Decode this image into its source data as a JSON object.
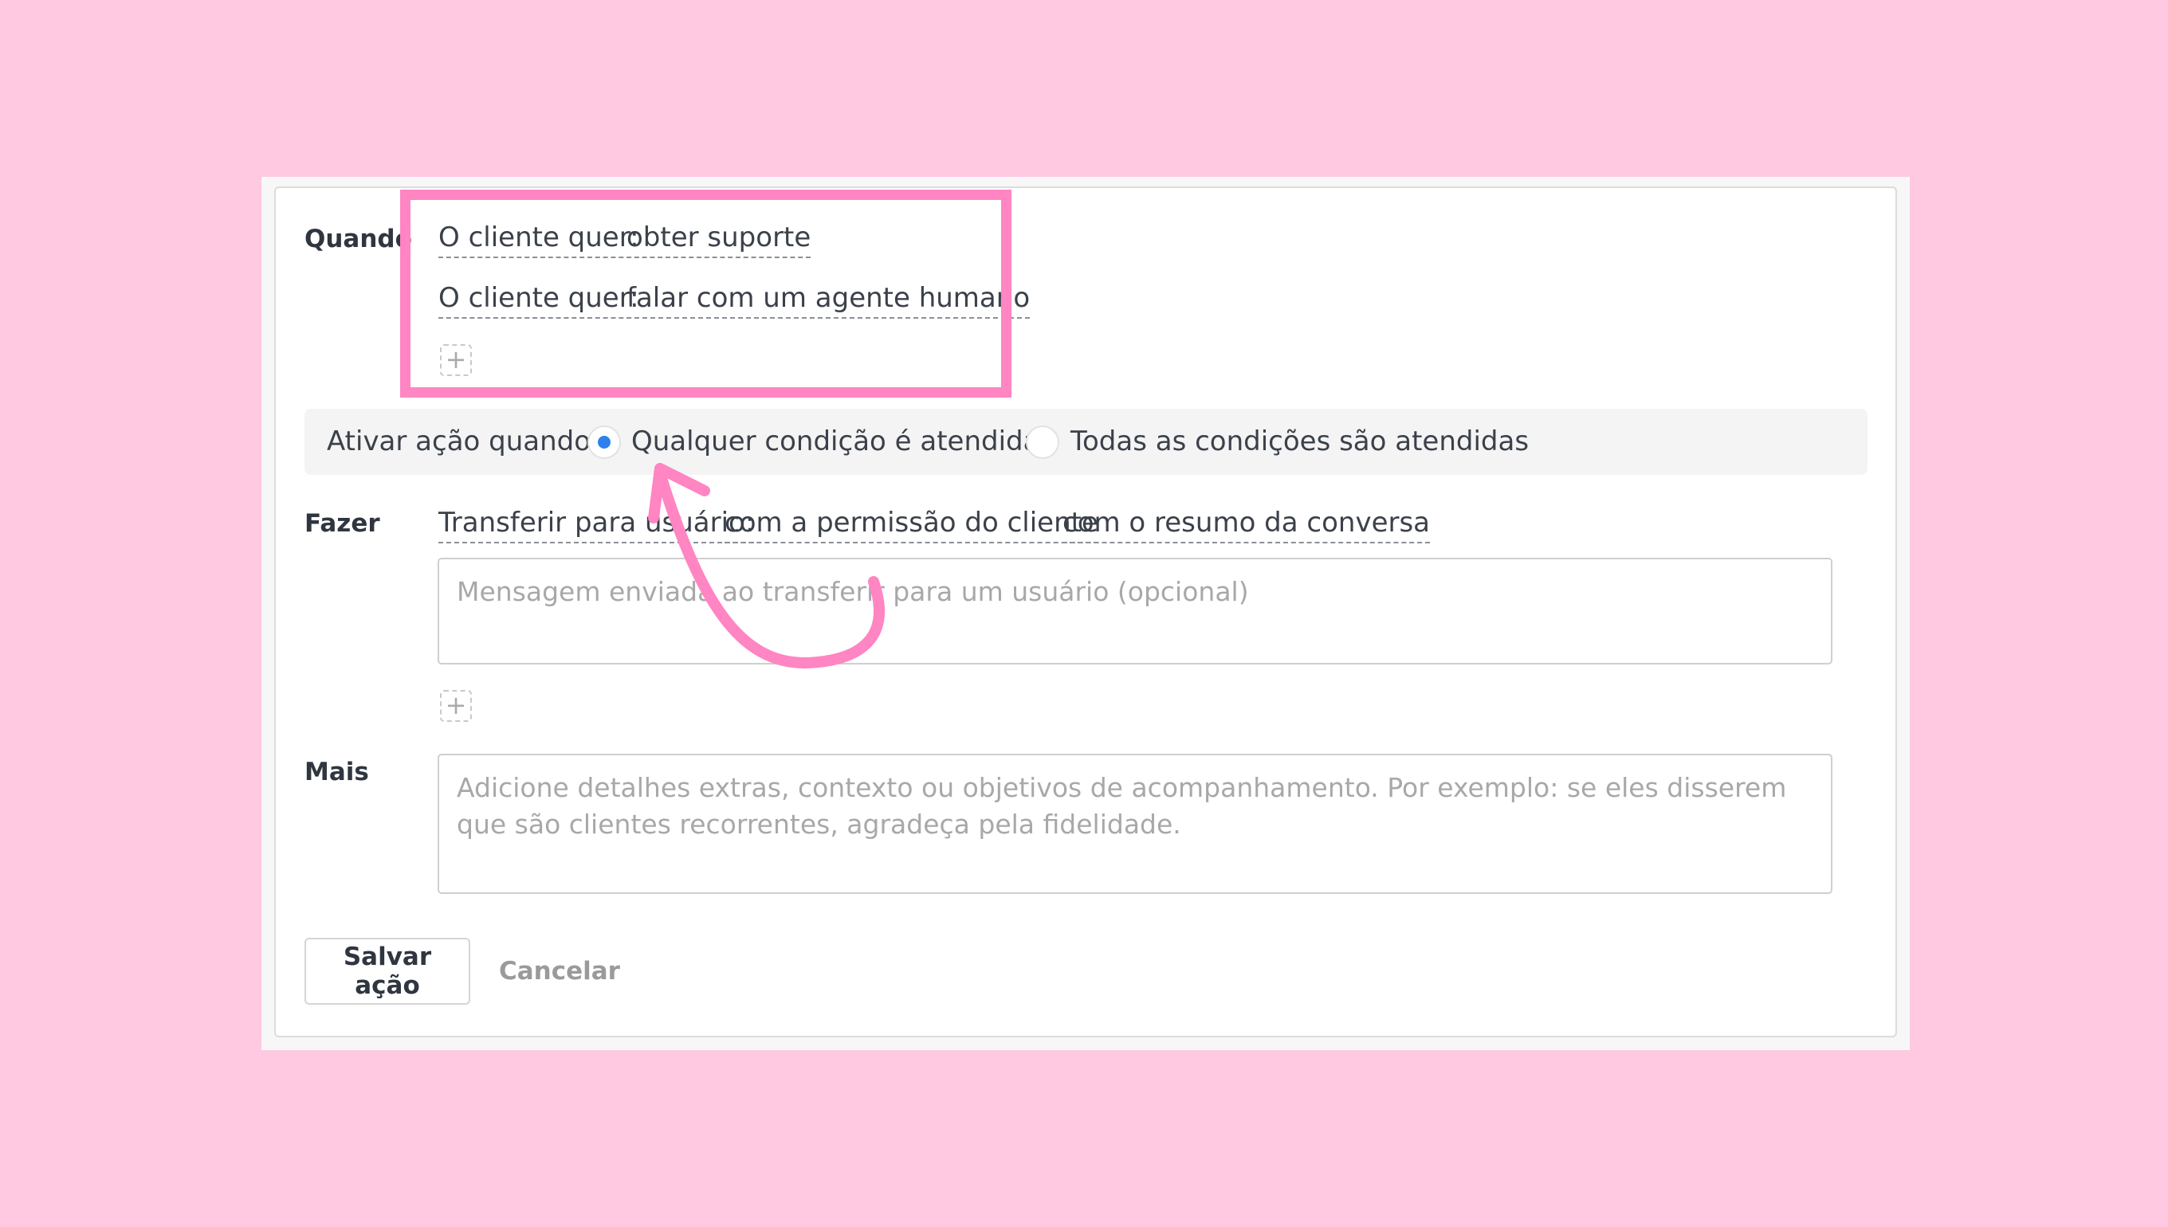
{
  "when": {
    "label": "Quando",
    "conditions": [
      {
        "key": "O cliente quer:",
        "value": "obter suporte"
      },
      {
        "key": "O cliente quer:",
        "value": "falar com um agente humano"
      }
    ],
    "add_symbol": "+"
  },
  "trigger": {
    "label": "Ativar ação quando:",
    "options": [
      {
        "label": "Qualquer condição é atendida",
        "selected": true
      },
      {
        "label": "Todas as condições são atendidas",
        "selected": false
      }
    ]
  },
  "do": {
    "label": "Fazer",
    "action": "Transferir para usuário:",
    "option1": "com a permissão do cliente",
    "option2": "com o resumo da conversa",
    "message_placeholder": "Mensagem enviada ao transferir para um usuário (opcional)",
    "add_symbol": "+"
  },
  "more": {
    "label": "Mais",
    "placeholder": "Adicione detalhes extras, contexto ou objetivos de acompanhamento. Por exemplo: se eles disserem que são clientes recorrentes, agradeça pela fidelidade."
  },
  "buttons": {
    "save": "Salvar ação",
    "cancel": "Cancelar"
  },
  "colors": {
    "background": "#ffc9e1",
    "highlight": "#ff85c3",
    "radio_selected": "#2f80ed"
  }
}
